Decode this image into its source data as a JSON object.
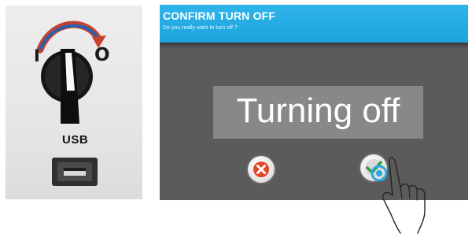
{
  "switch_panel": {
    "label_on": "I",
    "label_off": "O",
    "usb_label": "USB"
  },
  "screen": {
    "title": "CONFIRM TURN OFF",
    "subtitle": "Do you really want to turn off ?",
    "status_text": "Turning off",
    "header_color": "#1ba3dc",
    "background_color": "#5b5b5b"
  },
  "buttons": {
    "cancel_icon": "cross-icon",
    "confirm_icon": "check-icon",
    "cancel_color": "#e2452a",
    "confirm_color": "#2e9e3a"
  }
}
